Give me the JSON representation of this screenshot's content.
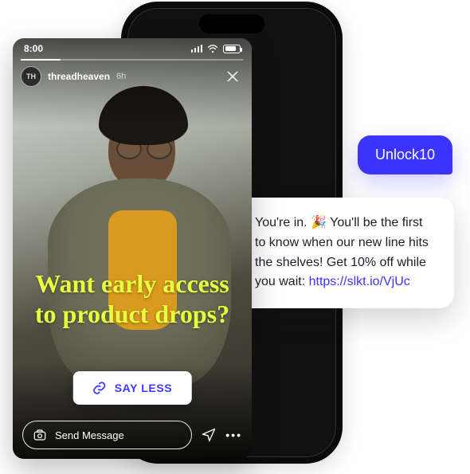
{
  "status": {
    "time": "8:00"
  },
  "story": {
    "avatar_initials": "TH",
    "handle": "threadheaven",
    "age": "6h",
    "headline": "Want early access to product drops?",
    "cta_label": "SAY LESS",
    "reply_placeholder": "Send Message"
  },
  "chat": {
    "user_bubble": "Unlock10",
    "reply_text_before": "You're in. 🎉 You'll be the first to know when our new line hits the shelves! Get 10% off while you wait: ",
    "reply_link_text": "https://slkt.io/VjUc"
  }
}
